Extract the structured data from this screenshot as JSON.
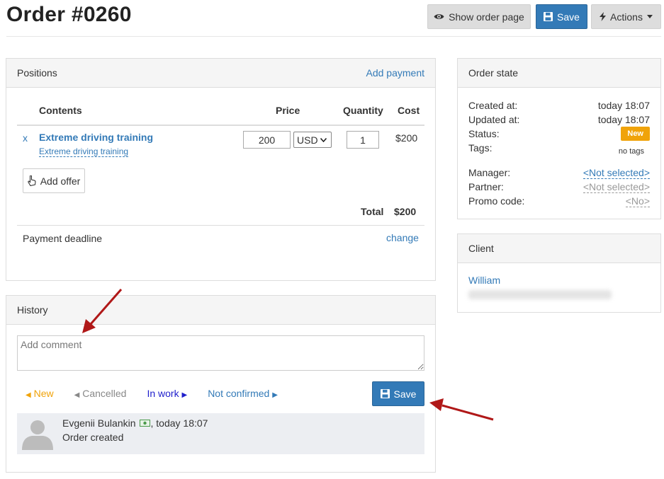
{
  "header": {
    "title": "Order #0260",
    "show_order_page": "Show order page",
    "save": "Save",
    "actions": "Actions"
  },
  "positions": {
    "title": "Positions",
    "add_payment": "Add payment",
    "columns": {
      "contents": "Contents",
      "price": "Price",
      "quantity": "Quantity",
      "cost": "Cost"
    },
    "row": {
      "remove": "x",
      "name": "Extreme driving training",
      "offer": "Extreme driving training",
      "price": "200",
      "currency": "USD",
      "quantity": "1",
      "cost": "$200"
    },
    "add_offer": "Add offer",
    "total_label": "Total",
    "total_value": "$200",
    "payment_deadline": "Payment deadline",
    "change": "change"
  },
  "history": {
    "title": "History",
    "comment_placeholder": "Add comment",
    "statuses": [
      {
        "label": "New",
        "color": "#f0a30a"
      },
      {
        "label": "Cancelled",
        "color": "#888888"
      },
      {
        "label": "In work",
        "color": "#2020cc"
      },
      {
        "label": "Not confirmed",
        "color": "#337ab7"
      }
    ],
    "save": "Save",
    "entry": {
      "author": "Evgenii Bulankin",
      "time": ", today 18:07",
      "text": "Order created"
    }
  },
  "order_state": {
    "title": "Order state",
    "created_label": "Created at:",
    "created_value": "today 18:07",
    "updated_label": "Updated at:",
    "updated_value": "today 18:07",
    "status_label": "Status:",
    "status_value": "New",
    "tags_label": "Tags:",
    "tags_value": "no tags",
    "manager_label": "Manager:",
    "manager_value": "<Not selected>",
    "partner_label": "Partner:",
    "partner_value": "<Not selected>",
    "promo_label": "Promo code:",
    "promo_value": "<No>"
  },
  "client": {
    "title": "Client",
    "name": "William"
  },
  "colors": {
    "primary": "#337ab7",
    "status_new": "#f0a30a",
    "annotation_arrow": "#b01818"
  }
}
